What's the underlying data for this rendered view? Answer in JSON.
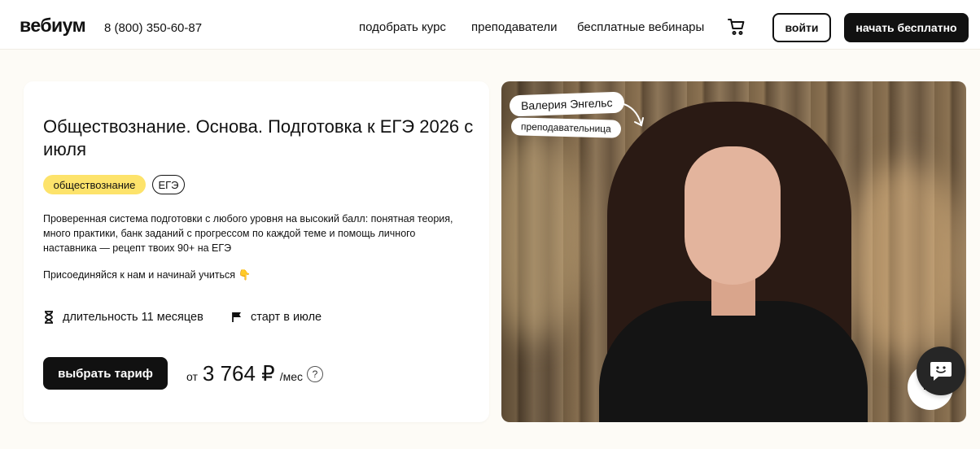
{
  "header": {
    "logo": "вебиум",
    "phone": "8 (800) 350-60-87",
    "nav": [
      "подобрать курс",
      "преподаватели",
      "бесплатные вебинары"
    ],
    "login_label": "войти",
    "start_label": "начать бесплатно"
  },
  "course": {
    "title": "Обществознание. Основа. Подготовка к ЕГЭ 2026 с июля",
    "tags": [
      "обществознание",
      "ЕГЭ"
    ],
    "description": "Проверенная система подготовки с любого уровня на высокий балл: понятная теория, много практики, банк заданий с прогрессом по каждой теме и помощь личного наставника — рецепт твоих 90+ на ЕГЭ",
    "join_text": "Присоединяйся к нам и начинай учиться 👇",
    "duration": "длительность 11 месяцев",
    "start": "старт в июле",
    "choose_label": "выбрать тариф",
    "price_from": "от",
    "price_value": "3 764 ₽",
    "price_unit": "/мес",
    "help_label": "?"
  },
  "video": {
    "teacher_name": "Валерия Энгельс",
    "teacher_role": "преподавательница"
  },
  "colors": {
    "accent": "#fde36b",
    "dark": "#111111",
    "background": "#fdfbf6"
  }
}
